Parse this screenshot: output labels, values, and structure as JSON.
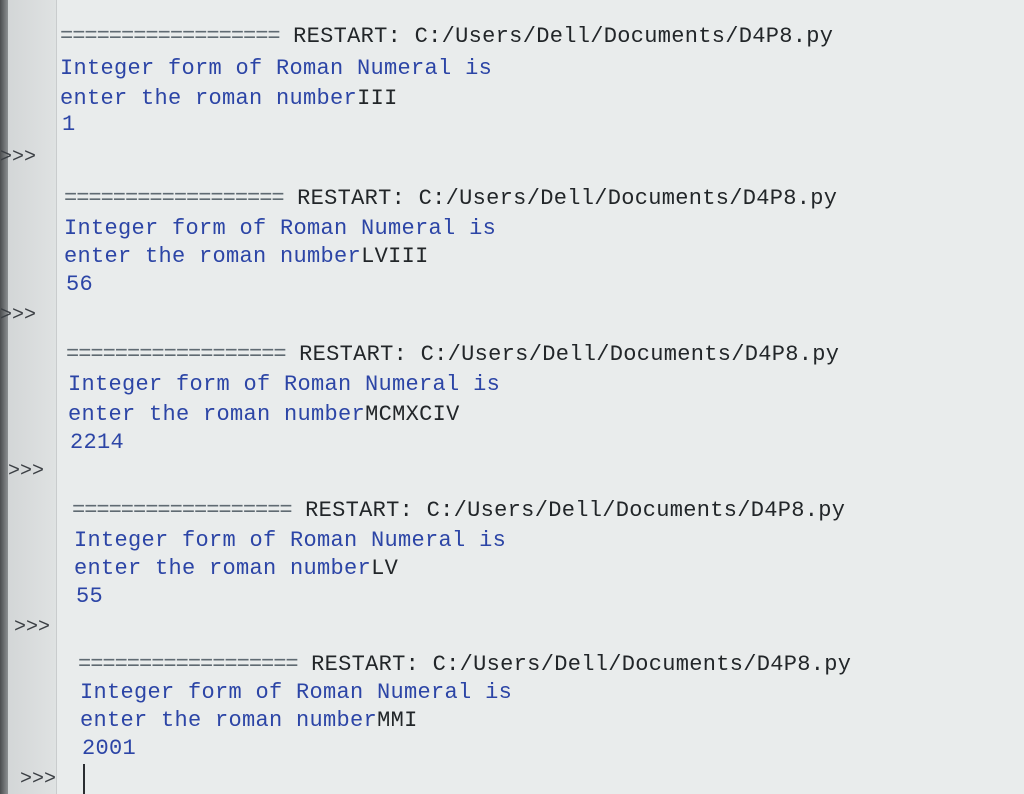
{
  "shell": {
    "runs": [
      {
        "restart_bar": "==================",
        "restart_label": " RESTART: ",
        "restart_path": "C:/Users/Dell/Documents/D4P8.py",
        "output_line": "Integer form of Roman Numeral is",
        "input_prompt": "enter the roman number",
        "input_value": "III",
        "result": "1",
        "prompt": ">>>"
      },
      {
        "restart_bar": "==================",
        "restart_label": " RESTART: ",
        "restart_path": "C:/Users/Dell/Documents/D4P8.py",
        "output_line": "Integer form of Roman Numeral is",
        "input_prompt": "enter the roman number",
        "input_value": "LVIII",
        "result": "56",
        "prompt": ">>>"
      },
      {
        "restart_bar": "==================",
        "restart_label": " RESTART: ",
        "restart_path": "C:/Users/Dell/Documents/D4P8.py",
        "output_line": "Integer form of Roman Numeral is",
        "input_prompt": "enter the roman number",
        "input_value": "MCMXCIV",
        "result": "2214",
        "prompt": ">>>"
      },
      {
        "restart_bar": "==================",
        "restart_label": " RESTART: ",
        "restart_path": "C:/Users/Dell/Documents/D4P8.py",
        "output_line": "Integer form of Roman Numeral is",
        "input_prompt": "enter the roman number",
        "input_value": "LV",
        "result": "55",
        "prompt": ">>>"
      },
      {
        "restart_bar": "==================",
        "restart_label": " RESTART: ",
        "restart_path": "C:/Users/Dell/Documents/D4P8.py",
        "output_line": "Integer form of Roman Numeral is",
        "input_prompt": "enter the roman number",
        "input_value": "MMI",
        "result": "2001",
        "prompt": ">>>"
      }
    ]
  }
}
